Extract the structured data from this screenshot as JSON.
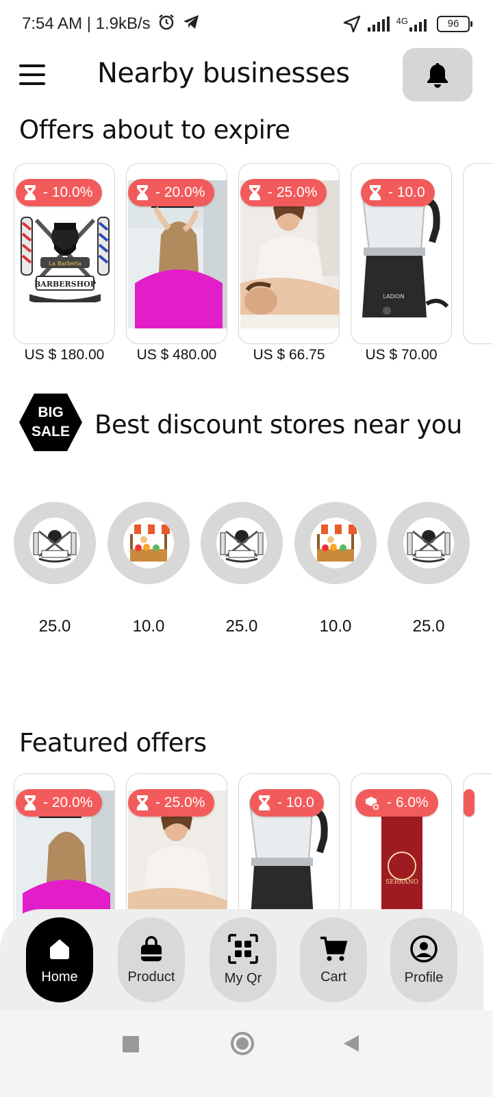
{
  "status_bar": {
    "time": "7:54 AM | 1.9kB/s",
    "network": "4G",
    "battery": "96"
  },
  "app_bar": {
    "title": "Nearby businesses"
  },
  "expiring": {
    "title": "Offers about to expire",
    "items": [
      {
        "badge": "- 10.0%",
        "price": "US $ 180.00",
        "image": "barbershop-logo"
      },
      {
        "badge": "- 20.0%",
        "price": "US $ 480.00",
        "image": "hair-salon"
      },
      {
        "badge": "- 25.0%",
        "price": "US $ 66.75",
        "image": "massage"
      },
      {
        "badge": "- 10.0",
        "price": "US $ 70.00",
        "image": "espresso-maker"
      }
    ]
  },
  "discount_stores": {
    "title": "Best discount stores near you",
    "badge_line1": "BIG",
    "badge_line2": "SALE",
    "stores": [
      {
        "discount": "25.0",
        "image": "barbershop-logo"
      },
      {
        "discount": "10.0",
        "image": "market-stall"
      },
      {
        "discount": "25.0",
        "image": "barbershop-logo"
      },
      {
        "discount": "10.0",
        "image": "market-stall"
      },
      {
        "discount": "25.0",
        "image": "barbershop-logo"
      }
    ]
  },
  "featured": {
    "title": "Featured offers",
    "items": [
      {
        "badge": "- 20.0%",
        "image": "hair-salon",
        "badge_icon": "hourglass-icon"
      },
      {
        "badge": "- 25.0%",
        "image": "massage",
        "badge_icon": "hourglass-icon"
      },
      {
        "badge": "- 10.0",
        "image": "espresso-maker",
        "badge_icon": "hourglass-icon"
      },
      {
        "badge": "- 6.0%",
        "image": "coffee-bag",
        "badge_icon": "box-plus-icon"
      }
    ]
  },
  "bottom_nav": {
    "home": "Home",
    "product": "Product",
    "myqr": "My Qr",
    "cart": "Cart",
    "profile": "Profile"
  },
  "colors": {
    "badge": "#f25b5b",
    "nav_active": "#000000",
    "nav_idle": "#d9d9d9"
  }
}
